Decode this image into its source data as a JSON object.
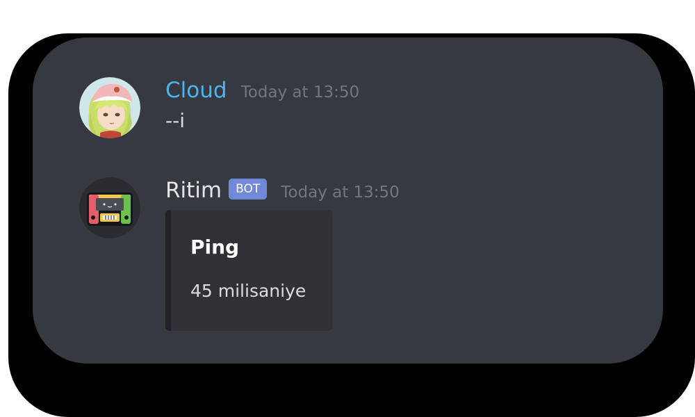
{
  "messages": [
    {
      "username": "Cloud",
      "username_color": "#4fb3f0",
      "timestamp": "Today at 13:50",
      "content": "--i",
      "avatar_icon": "anime-girl-avatar"
    },
    {
      "username": "Ritim",
      "username_color": "#e6e7e9",
      "bot_tag": "BOT",
      "timestamp": "Today at 13:50",
      "avatar_icon": "cassette-tape-avatar",
      "embed": {
        "title": "Ping",
        "description": "45 milisaniye"
      }
    }
  ],
  "colors": {
    "background": "#36393f",
    "embed_background": "#2f3136",
    "bot_tag": "#7289da",
    "timestamp": "#72767d"
  }
}
